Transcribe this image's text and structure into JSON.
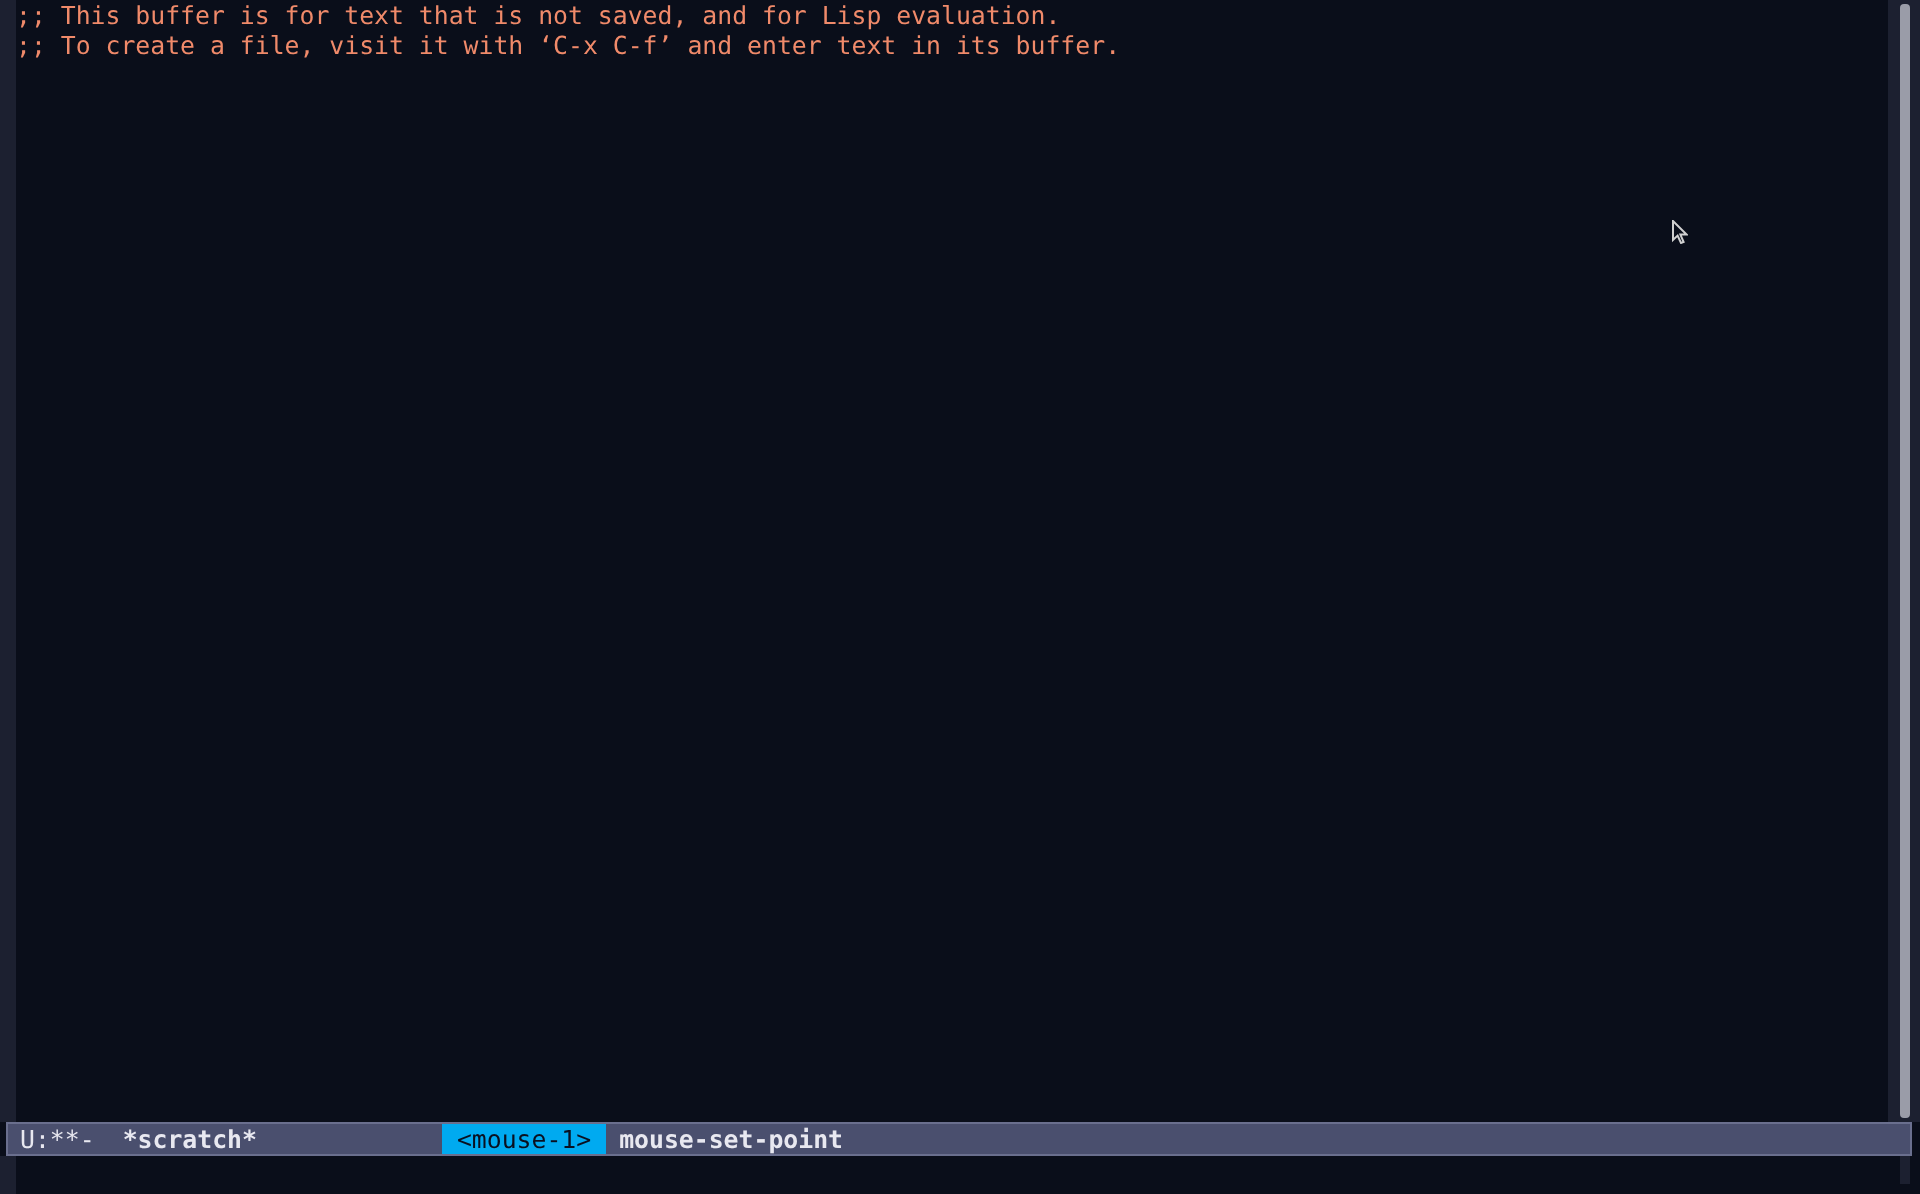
{
  "buffer": {
    "lines": [
      ";; This buffer is for text that is not saved, and for Lisp evaluation.",
      ";; To create a file, visit it with ‘C-x C-f’ and enter text in its buffer."
    ]
  },
  "mode_line": {
    "status": "U:**-",
    "buffer_name": "*scratch*",
    "key": "<mouse-1>",
    "command": "mouse-set-point"
  }
}
